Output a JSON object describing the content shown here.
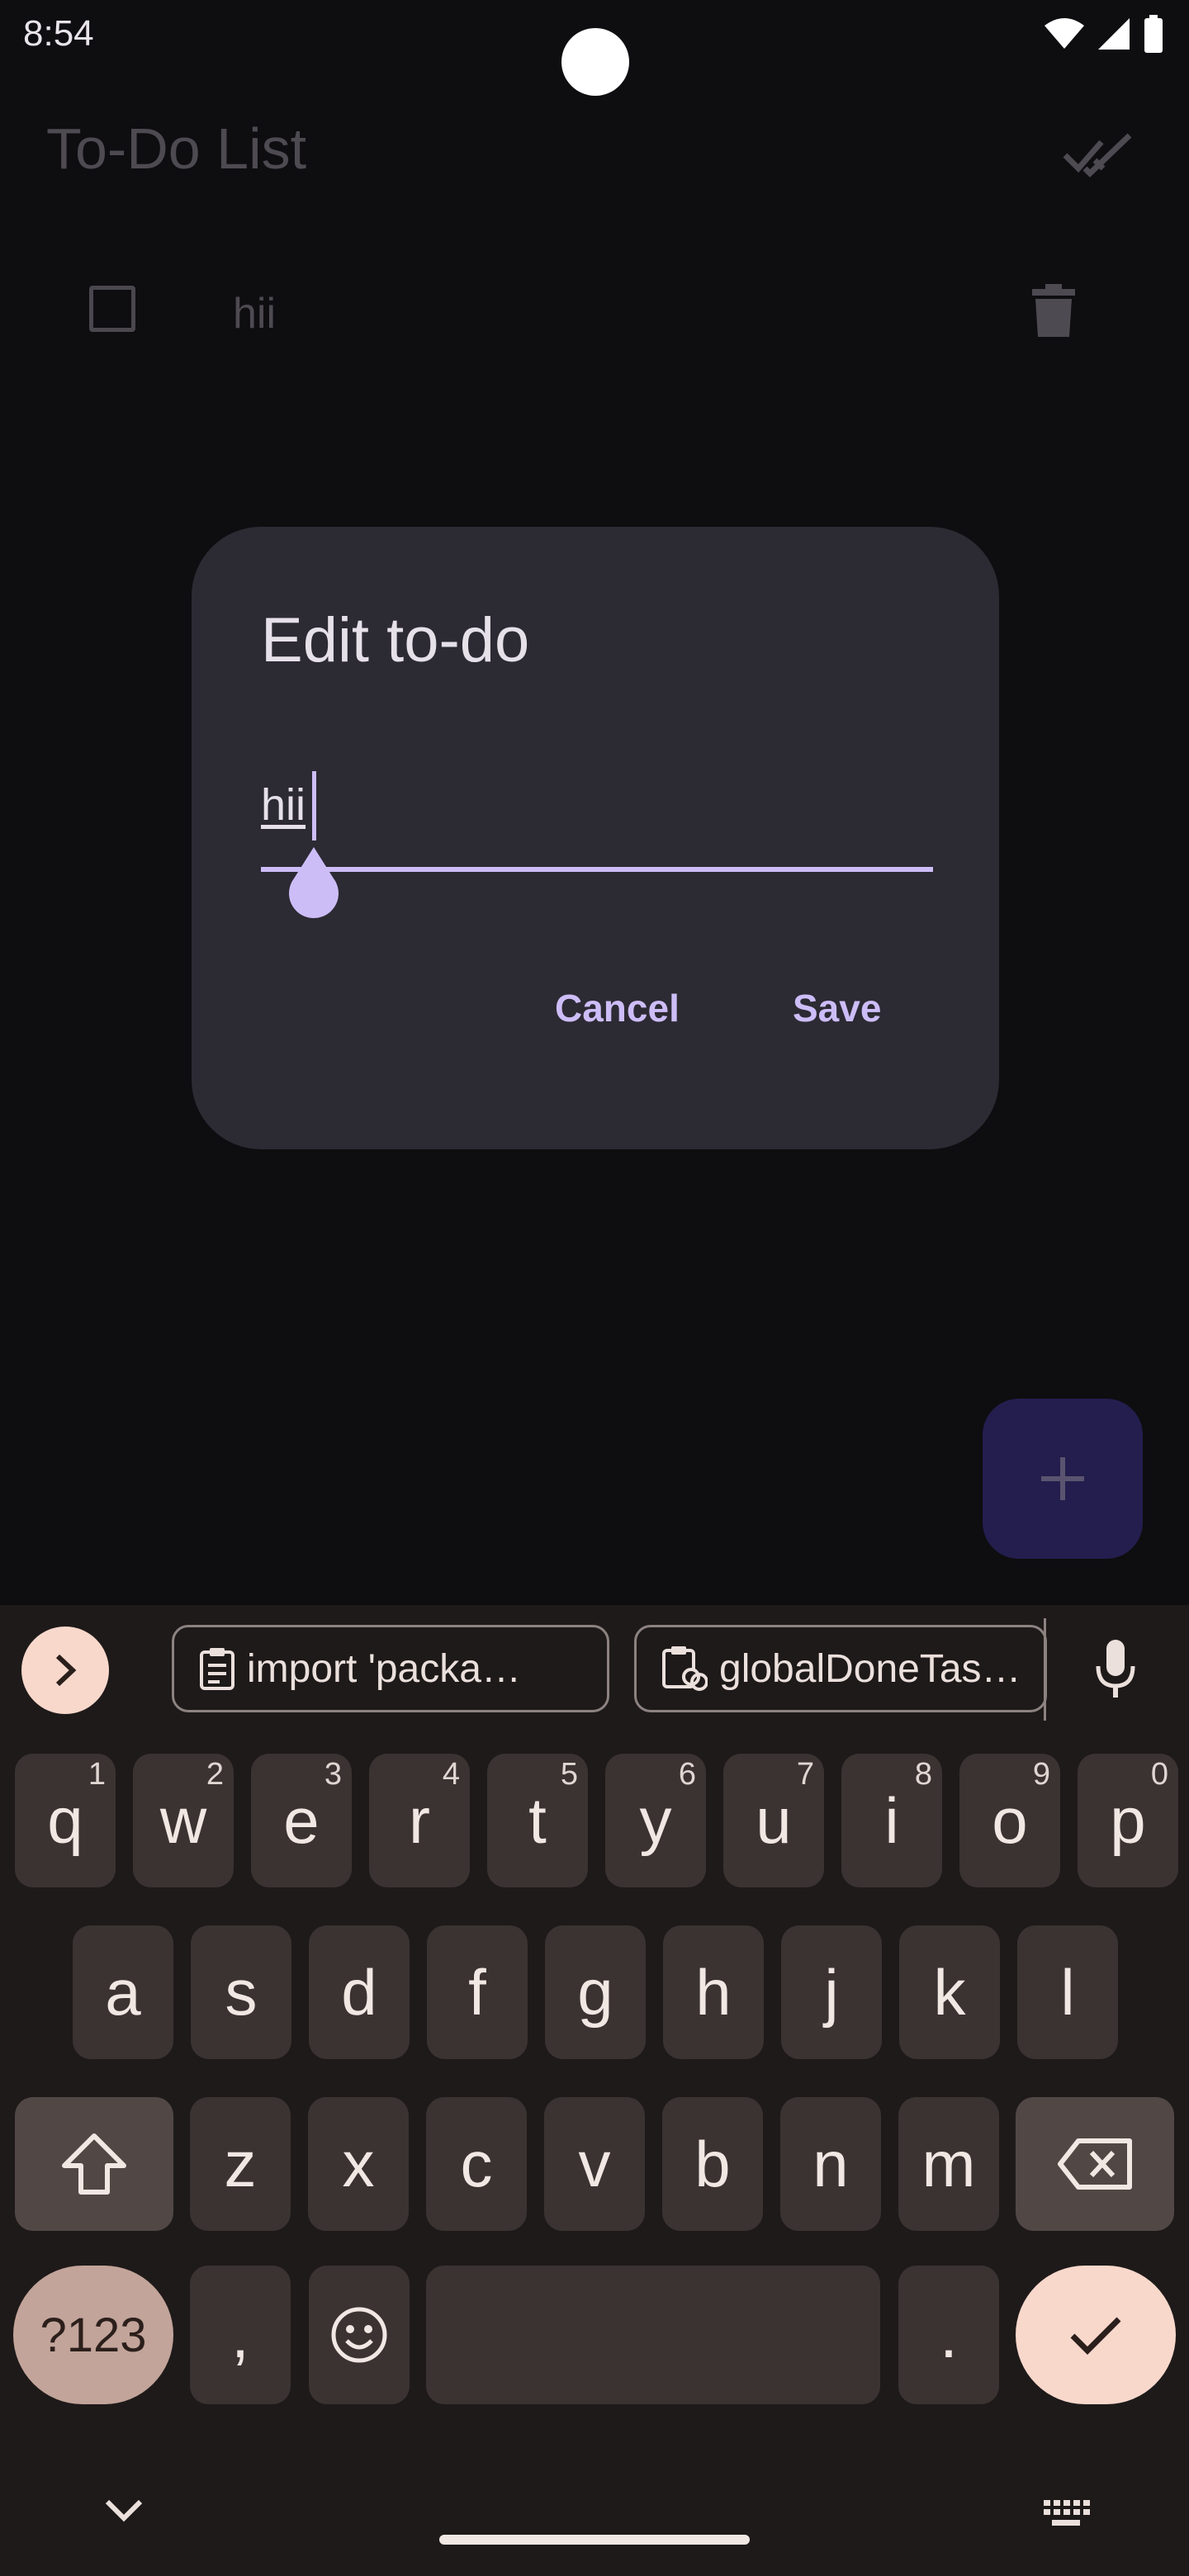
{
  "status_bar": {
    "time": "8:54"
  },
  "app_bar": {
    "title": "To-Do List"
  },
  "todo_items": [
    {
      "text": "hii",
      "done": false
    }
  ],
  "dialog": {
    "title": "Edit to-do",
    "input_value": "hii",
    "cancel_label": "Cancel",
    "save_label": "Save"
  },
  "keyboard": {
    "clipboard_chips": [
      {
        "label": "import 'packa…",
        "icon": "clipboard-icon"
      },
      {
        "label": "globalDoneTas…",
        "icon": "clipboard-link-icon"
      }
    ],
    "row1": [
      {
        "k": "q",
        "s": "1"
      },
      {
        "k": "w",
        "s": "2"
      },
      {
        "k": "e",
        "s": "3"
      },
      {
        "k": "r",
        "s": "4"
      },
      {
        "k": "t",
        "s": "5"
      },
      {
        "k": "y",
        "s": "6"
      },
      {
        "k": "u",
        "s": "7"
      },
      {
        "k": "i",
        "s": "8"
      },
      {
        "k": "o",
        "s": "9"
      },
      {
        "k": "p",
        "s": "0"
      }
    ],
    "row2": [
      "a",
      "s",
      "d",
      "f",
      "g",
      "h",
      "j",
      "k",
      "l"
    ],
    "row3": [
      "z",
      "x",
      "c",
      "v",
      "b",
      "n",
      "m"
    ],
    "num_label": "?123",
    "comma": ",",
    "period": "."
  },
  "colors": {
    "background": "#0e0d10",
    "dialog": "#2c2a33",
    "accent": "#cdbdf7",
    "keyboard_bg": "#1e1a19",
    "key": "#3a3332",
    "keyboard_accent": "#f9d8cc"
  }
}
